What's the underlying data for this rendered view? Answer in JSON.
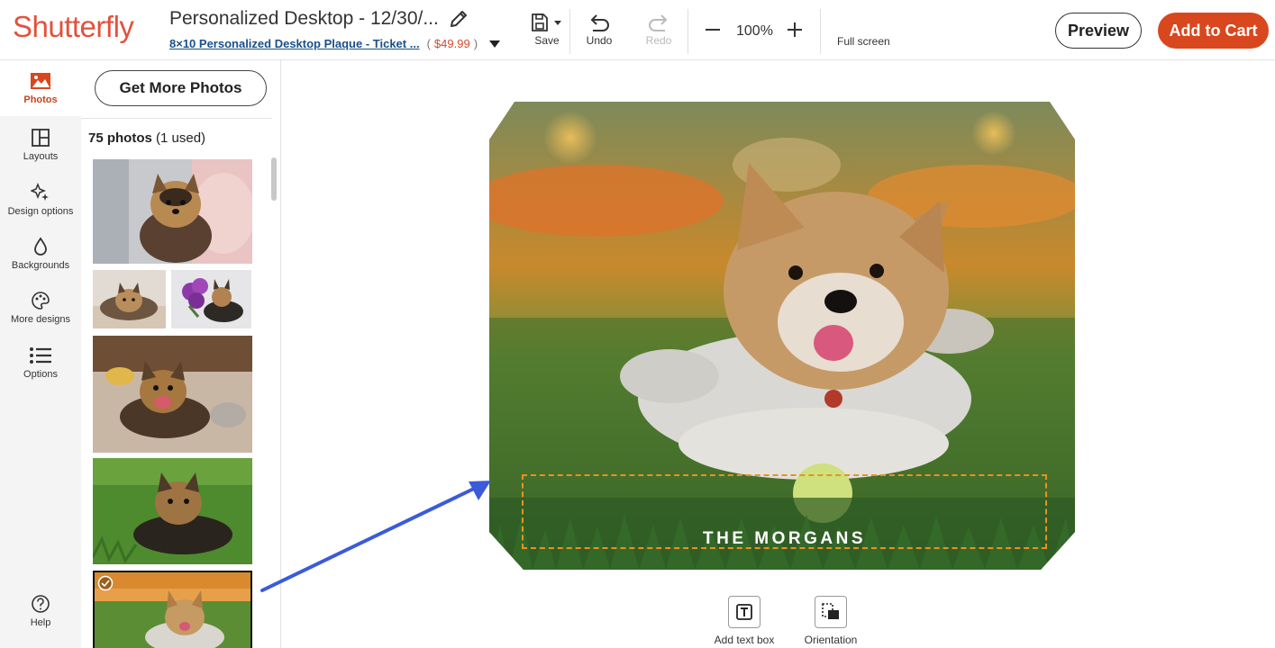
{
  "header": {
    "logo": "Shutterfly",
    "project_title": "Personalized Desktop - 12/30/...",
    "product_name": "8×10 Personalized Desktop Plaque - Ticket ...",
    "price": "$49.99",
    "tools": {
      "save": "Save",
      "undo": "Undo",
      "redo": "Redo",
      "zoom": "100%",
      "fullscreen": "Full screen"
    },
    "preview_label": "Preview",
    "cart_label": "Add to Cart"
  },
  "nav": {
    "items": [
      {
        "label": "Photos",
        "icon": "image-icon",
        "active": true
      },
      {
        "label": "Layouts",
        "icon": "layout-icon"
      },
      {
        "label": "Design options",
        "icon": "sparkle-icon"
      },
      {
        "label": "Backgrounds",
        "icon": "drop-icon"
      },
      {
        "label": "More designs",
        "icon": "palette-icon"
      },
      {
        "label": "Options",
        "icon": "list-icon"
      }
    ],
    "help": "Help"
  },
  "panel": {
    "get_more": "Get More Photos",
    "count_num": "75 photos",
    "count_used": "(1 used)"
  },
  "canvas": {
    "plaque_text": "THE MORGANS",
    "tools": {
      "add_text": "Add text box",
      "orientation": "Orientation"
    }
  },
  "colors": {
    "brand": "#e1523d",
    "cart": "#d9471e",
    "frame": "#e8921e",
    "arrow": "#3b5bdb"
  }
}
